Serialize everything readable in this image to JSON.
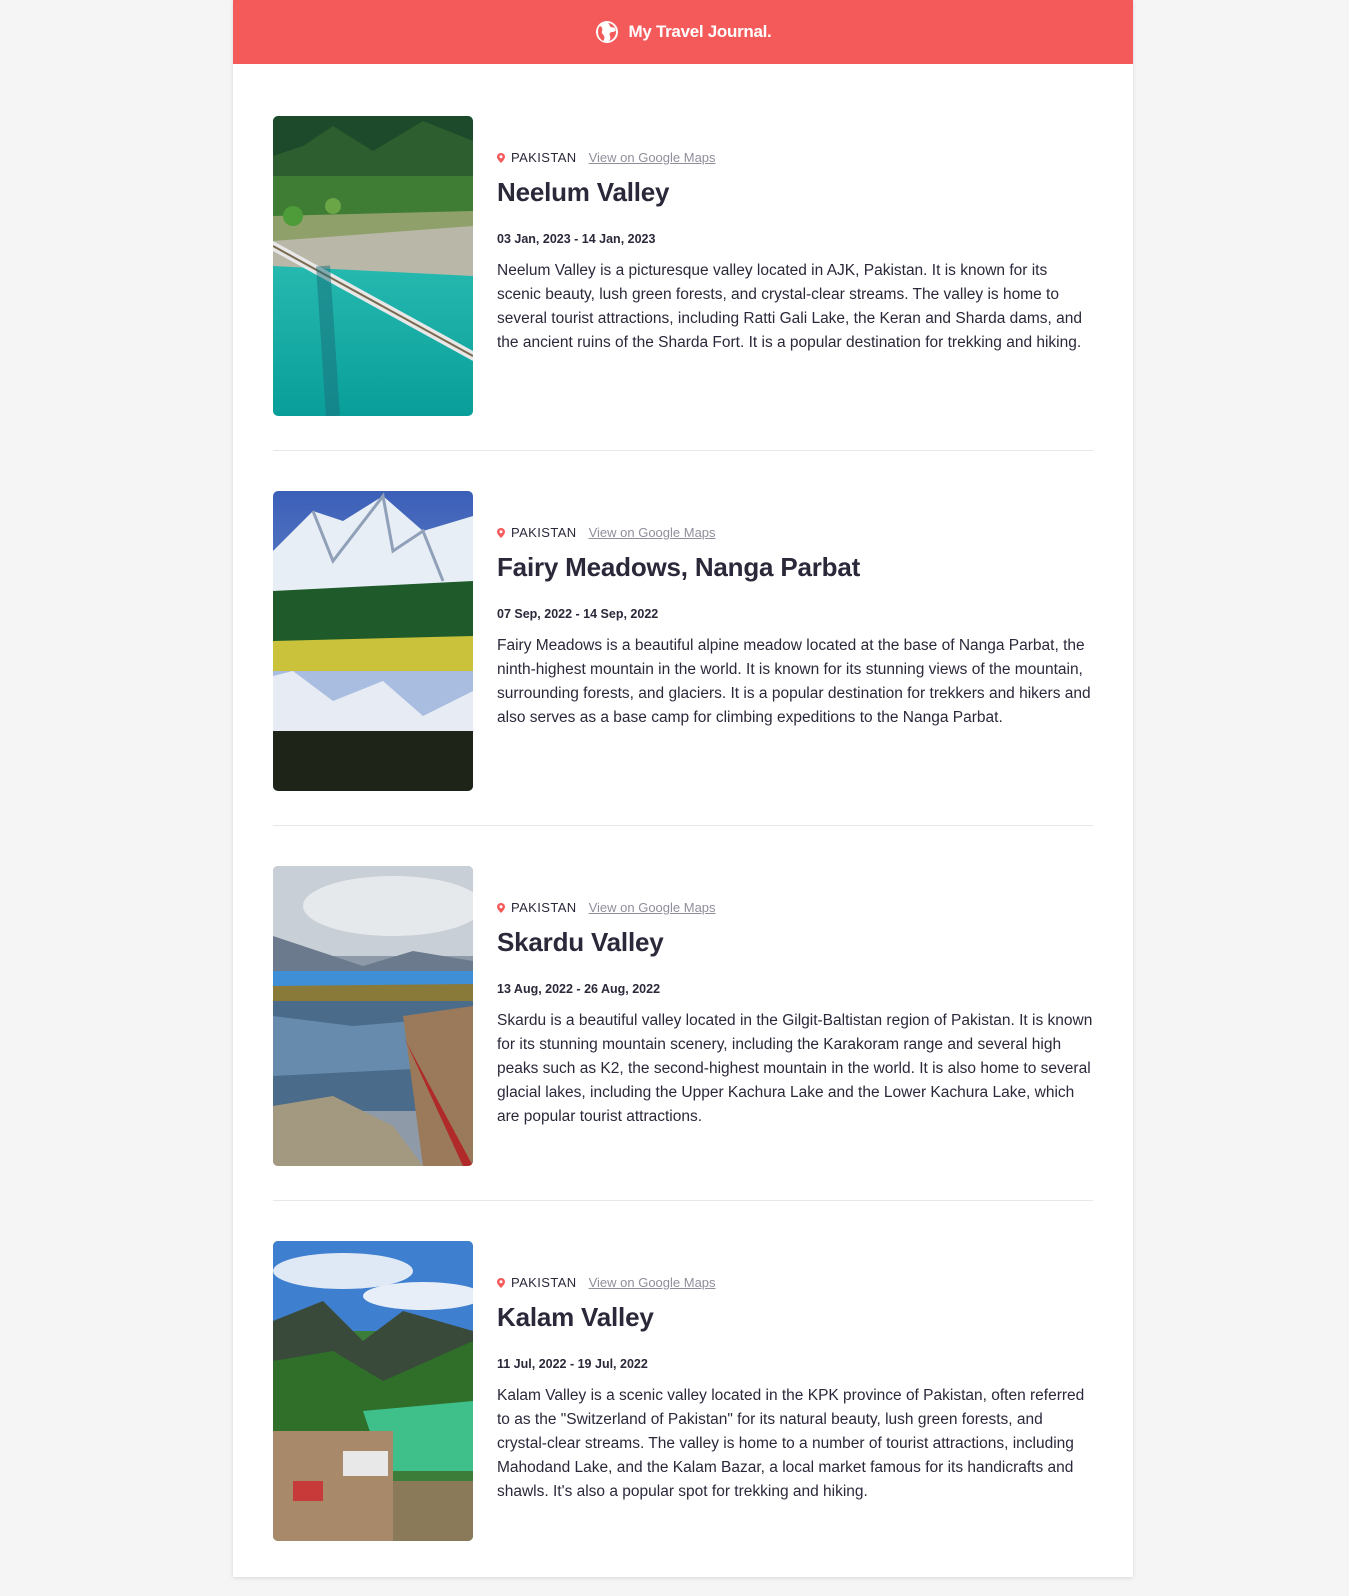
{
  "header": {
    "title": "My Travel Journal.",
    "icon": "globe-icon",
    "background": "#F55A5A"
  },
  "entries": [
    {
      "country": "PAKISTAN",
      "maps_link": "View on Google Maps",
      "title": "Neelum Valley",
      "dates": "03 Jan, 2023 - 14 Jan, 2023",
      "description": "Neelum Valley is a picturesque valley located in AJK, Pakistan. It is known for its scenic beauty, lush green forests, and crystal-clear streams. The valley is home to several tourist attractions, including Ratti Gali Lake, the Keran and Sharda dams, and the ancient ruins of the Sharda Fort. It is a popular destination for trekking and hiking."
    },
    {
      "country": "PAKISTAN",
      "maps_link": "View on Google Maps",
      "title": "Fairy Meadows, Nanga Parbat",
      "dates": "07 Sep, 2022 - 14 Sep, 2022",
      "description": "Fairy Meadows is a beautiful alpine meadow located at the base of Nanga Parbat, the ninth-highest mountain in the world. It is known for its stunning views of the mountain, surrounding forests, and glaciers. It is a popular destination for trekkers and hikers and also serves as a base camp for climbing expeditions to the Nanga Parbat."
    },
    {
      "country": "PAKISTAN",
      "maps_link": "View on Google Maps",
      "title": "Skardu Valley",
      "dates": "13 Aug, 2022 - 26 Aug, 2022",
      "description": "Skardu is a beautiful valley located in the Gilgit-Baltistan region of Pakistan. It is known for its stunning mountain scenery, including the Karakoram range and several high peaks such as K2, the second-highest mountain in the world. It is also home to several glacial lakes, including the Upper Kachura Lake and the Lower Kachura Lake, which are popular tourist attractions."
    },
    {
      "country": "PAKISTAN",
      "maps_link": "View on Google Maps",
      "title": "Kalam Valley",
      "dates": "11 Jul, 2022 - 19 Jul, 2022",
      "description": "Kalam Valley is a scenic valley located in the KPK province of Pakistan, often referred to as the \"Switzerland of Pakistan\" for its natural beauty, lush green forests, and crystal-clear streams. The valley is home to a number of tourist attractions, including Mahodand Lake, and the Kalam Bazar, a local market famous for its handicrafts and shawls. It's also a popular spot for trekking and hiking."
    }
  ]
}
